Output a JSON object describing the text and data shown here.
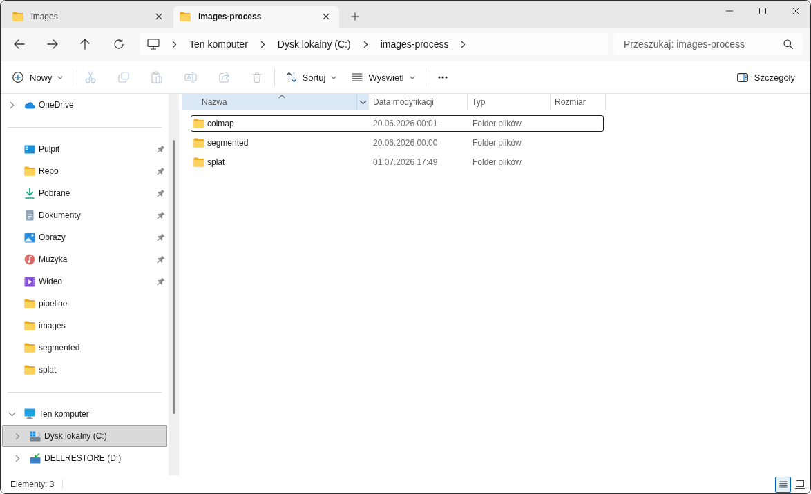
{
  "window": {
    "tabs": [
      {
        "label": "images",
        "selected": false
      },
      {
        "label": "images-process",
        "selected": true
      }
    ]
  },
  "address_bar": {
    "breadcrumb": [
      "Ten komputer",
      "Dysk lokalny (C:)",
      "images-process"
    ]
  },
  "search": {
    "placeholder": "Przeszukaj: images-process"
  },
  "toolbar": {
    "new": {
      "label": "Nowy"
    },
    "actions": [
      {
        "kind": "cut",
        "disabled": true
      },
      {
        "kind": "copy",
        "disabled": true
      },
      {
        "kind": "paste",
        "disabled": true
      },
      {
        "kind": "rename",
        "disabled": true
      },
      {
        "kind": "share",
        "disabled": true
      },
      {
        "kind": "delete",
        "disabled": true
      }
    ],
    "sort": {
      "label": "Sortuj"
    },
    "view": {
      "label": "Wyświetl"
    },
    "details": {
      "label": "Szczegóły"
    }
  },
  "sidebar": {
    "groups": [
      {
        "items": [
          {
            "label": "OneDrive",
            "kind": "cloud",
            "expanded": false,
            "selected": false
          }
        ]
      },
      {
        "items": [
          {
            "label": "Pulpit",
            "kind": "desktop",
            "pinned": true,
            "selected": false
          },
          {
            "label": "Repo",
            "kind": "folder",
            "pinned": true,
            "selected": false
          },
          {
            "label": "Pobrane",
            "kind": "downloads",
            "pinned": true,
            "selected": false
          },
          {
            "label": "Dokumenty",
            "kind": "documents",
            "pinned": true,
            "selected": false
          },
          {
            "label": "Obrazy",
            "kind": "pictures",
            "pinned": true,
            "selected": false
          },
          {
            "label": "Muzyka",
            "kind": "music",
            "pinned": true,
            "selected": false
          },
          {
            "label": "Wideo",
            "kind": "videos",
            "pinned": true,
            "selected": false
          },
          {
            "label": "pipeline",
            "kind": "folder",
            "pinned": false,
            "selected": false
          },
          {
            "label": "images",
            "kind": "folder",
            "pinned": false,
            "selected": false
          },
          {
            "label": "segmented",
            "kind": "folder",
            "pinned": false,
            "selected": false
          },
          {
            "label": "splat",
            "kind": "folder",
            "pinned": false,
            "selected": false
          }
        ]
      },
      {
        "items": [
          {
            "label": "Ten komputer",
            "kind": "computer",
            "expanded": true,
            "selected": false,
            "children": [
              {
                "label": "Dysk lokalny (C:)",
                "kind": "drive",
                "expanded": false,
                "selected": true
              },
              {
                "label": "DELLRESTORE (D:)",
                "kind": "restore-drive",
                "expanded": false,
                "selected": false
              }
            ]
          }
        ]
      }
    ]
  },
  "file_list": {
    "columns": [
      {
        "label": "Nazwa",
        "sorted": true,
        "hovered": true
      },
      {
        "label": "Data modyfikacji",
        "sorted": false,
        "hovered": false
      },
      {
        "label": "Typ",
        "sorted": false,
        "hovered": false
      },
      {
        "label": "Rozmiar",
        "sorted": false,
        "hovered": false
      }
    ],
    "rows": [
      {
        "name": "colmap",
        "modified": "20.06.2026 00:01",
        "type": "Folder plików",
        "focused": true,
        "selected": false
      },
      {
        "name": "segmented",
        "modified": "20.06.2026 00:00",
        "type": "Folder plików",
        "focused": false,
        "selected": false
      },
      {
        "name": "splat",
        "modified": "01.07.2026 17:49",
        "type": "Folder plików",
        "focused": false,
        "selected": false
      }
    ]
  },
  "status_bar": {
    "item_count": "Elementy: 3",
    "views": [
      {
        "kind": "details",
        "selected": true
      },
      {
        "kind": "tiles",
        "selected": false
      }
    ]
  }
}
